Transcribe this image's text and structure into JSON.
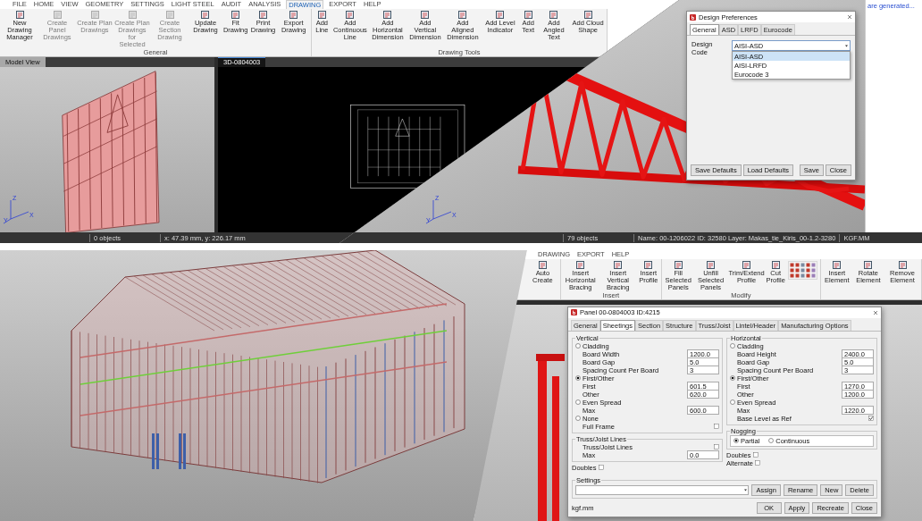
{
  "cad_window": {
    "ribbon_tabs": [
      {
        "label": "FILE",
        "selected": false
      },
      {
        "label": "HOME",
        "selected": false
      },
      {
        "label": "VIEW",
        "selected": false
      },
      {
        "label": "GEOMETRY",
        "selected": false
      },
      {
        "label": "SETTINGS",
        "selected": false
      },
      {
        "label": "LIGHT STEEL",
        "selected": false
      },
      {
        "label": "AUDIT",
        "selected": false
      },
      {
        "label": "ANALYSIS",
        "selected": false
      },
      {
        "label": "DRAWING",
        "selected": true
      },
      {
        "label": "EXPORT",
        "selected": false
      },
      {
        "label": "HELP",
        "selected": false
      }
    ],
    "ribbon_groups": [
      {
        "label": "General",
        "buttons": [
          {
            "label": "New Drawing Manager",
            "disabled": false
          },
          {
            "label": "Create Panel Drawings",
            "disabled": true
          },
          {
            "label": "Create Plan Drawings",
            "disabled": true
          },
          {
            "label": "Create Plan Drawings for Selected",
            "disabled": true
          },
          {
            "label": "Create Section Drawing",
            "disabled": true
          },
          {
            "label": "Update Drawing",
            "disabled": false
          },
          {
            "label": "Fit Drawing",
            "disabled": false
          },
          {
            "label": "Print Drawing",
            "disabled": false
          },
          {
            "label": "Export Drawing",
            "disabled": false
          }
        ]
      },
      {
        "label": "Drawing Tools",
        "buttons": [
          {
            "label": "Add Line",
            "disabled": false
          },
          {
            "label": "Add Continuous Line",
            "disabled": false
          },
          {
            "label": "Add Horizontal Dimension",
            "disabled": false
          },
          {
            "label": "Add Vertical Dimension",
            "disabled": false
          },
          {
            "label": "Add Aligned Dimension",
            "disabled": false
          },
          {
            "label": "Add Level Indicator",
            "disabled": false
          },
          {
            "label": "Add Text",
            "disabled": false
          },
          {
            "label": "Add Angled Text",
            "disabled": false
          },
          {
            "label": "Add Cloud Shape",
            "disabled": false
          }
        ]
      }
    ],
    "view_tabs": [
      {
        "label": "Model View",
        "selected": false
      },
      {
        "label": "3D-0804003",
        "selected": true
      }
    ],
    "axes": [
      "Z",
      "Y",
      "X"
    ],
    "status_bar": [
      "0 objects",
      "x: 47.39 mm, y: 226.17 mm"
    ]
  },
  "truss_window": {
    "axes": [
      "Z",
      "Y",
      "X"
    ],
    "dialog": {
      "title": "Design Preferences",
      "tabs": [
        {
          "label": "General",
          "selected": true
        },
        {
          "label": "ASD",
          "selected": false
        },
        {
          "label": "LRFD",
          "selected": false
        },
        {
          "label": "Eurocode",
          "selected": false
        }
      ],
      "field_label": "Design Code",
      "value": "AISI-ASD",
      "options": [
        {
          "label": "AISI-ASD",
          "selected": true
        },
        {
          "label": "AISI-LRFD",
          "selected": false
        },
        {
          "label": "Eurocode 3",
          "selected": false
        }
      ],
      "buttons": [
        "Save Defaults",
        "Load Defaults",
        "Save",
        "Close"
      ]
    },
    "status_bar": [
      "79 objects",
      "Name: 00-1206022 ID: 32580 Layer: Makas_tie_Kiris_00-1.2-3280",
      "KGF.MM"
    ],
    "side_note": "are generated..."
  },
  "panel_window": {
    "ribbon_tabs": [
      {
        "label": "DRAWING",
        "selected": false
      },
      {
        "label": "EXPORT",
        "selected": false
      },
      {
        "label": "HELP",
        "selected": false
      }
    ],
    "ribbon_groups": [
      {
        "buttons": [
          {
            "label": "Auto Create",
            "disabled": false
          }
        ]
      },
      {
        "label": "Insert",
        "buttons": [
          {
            "label": "Insert Horizontal Bracing",
            "disabled": false
          },
          {
            "label": "Insert Vertical Bracing",
            "disabled": false
          },
          {
            "label": "Insert Profile",
            "disabled": false
          }
        ]
      },
      {
        "label": "Modify",
        "icon_grid": true,
        "buttons": [
          {
            "label": "Fill Selected Panels",
            "disabled": false
          },
          {
            "label": "Unfill Selected Panels",
            "disabled": false
          },
          {
            "label": "Trim/Extend Profile",
            "disabled": false
          },
          {
            "label": "Cut Profile",
            "disabled": false
          }
        ]
      },
      {
        "buttons": [
          {
            "label": "Insert Element",
            "disabled": false
          },
          {
            "label": "Rotate Element",
            "disabled": false
          },
          {
            "label": "Remove Element",
            "disabled": false
          }
        ]
      }
    ],
    "dialog": {
      "title": "Panel 00-0804003 ID:4215",
      "tabs": [
        {
          "label": "General",
          "selected": false
        },
        {
          "label": "Sheetings",
          "selected": true
        },
        {
          "label": "Section",
          "selected": false
        },
        {
          "label": "Structure",
          "selected": false
        },
        {
          "label": "Truss/Joist",
          "selected": false
        },
        {
          "label": "Lintel/Header",
          "selected": false
        },
        {
          "label": "Manufacturing Options",
          "selected": false
        }
      ],
      "vertical": {
        "title": "Vertical",
        "rows": [
          {
            "kind": "radio",
            "label": "Cladding",
            "selected": false
          },
          {
            "kind": "field",
            "label": "Board Width",
            "value": "1200.0"
          },
          {
            "kind": "field",
            "label": "Board Gap",
            "value": "5.0"
          },
          {
            "kind": "field",
            "label": "Spacing Count Per Board",
            "value": "3"
          },
          {
            "kind": "radio",
            "label": "First/Other",
            "selected": true
          },
          {
            "kind": "field",
            "label": "First",
            "value": "601.5"
          },
          {
            "kind": "field",
            "label": "Other",
            "value": "620.0"
          },
          {
            "kind": "radio",
            "label": "Even Spread",
            "selected": false
          },
          {
            "kind": "field",
            "label": "Max",
            "value": "600.0"
          },
          {
            "kind": "radio",
            "label": "None",
            "selected": false
          },
          {
            "kind": "check",
            "label": "Full Frame",
            "checked": false
          }
        ]
      },
      "truss_lines": {
        "title": "Truss/Joist Lines",
        "rows": [
          {
            "kind": "check",
            "label": "Truss/Joist Lines",
            "checked": false
          },
          {
            "kind": "field",
            "label": "Max",
            "value": "0.0"
          }
        ]
      },
      "left_extra": [
        {
          "kind": "check",
          "label": "Doubles",
          "checked": false
        }
      ],
      "horizontal": {
        "title": "Horizontal",
        "rows": [
          {
            "kind": "radio",
            "label": "Cladding",
            "selected": false
          },
          {
            "kind": "field",
            "label": "Board Height",
            "value": "2400.0"
          },
          {
            "kind": "field",
            "label": "Board Gap",
            "value": "5.0"
          },
          {
            "kind": "field",
            "label": "Spacing Count Per Board",
            "value": "3"
          },
          {
            "kind": "radio",
            "label": "First/Other",
            "selected": true
          },
          {
            "kind": "field",
            "label": "First",
            "value": "1270.0"
          },
          {
            "kind": "field",
            "label": "Other",
            "value": "1200.0"
          },
          {
            "kind": "radio",
            "label": "Even Spread",
            "selected": false
          },
          {
            "kind": "field",
            "label": "Max",
            "value": "1220.0"
          },
          {
            "kind": "check",
            "label": "Base Level as Ref",
            "checked": true
          }
        ]
      },
      "nogging": {
        "title": "Nogging",
        "options": [
          {
            "label": "Partial",
            "selected": true
          },
          {
            "label": "Continuous",
            "selected": false
          }
        ]
      },
      "right_extra": [
        {
          "kind": "check",
          "label": "Doubles",
          "checked": false
        },
        {
          "kind": "check",
          "label": "Alternate",
          "checked": false
        }
      ],
      "settings": {
        "title": "Settings",
        "buttons": [
          "Assign",
          "Rename",
          "New",
          "Delete"
        ]
      },
      "unit": "kgf.mm",
      "buttons": [
        "OK",
        "Apply",
        "Recreate",
        "Close"
      ]
    }
  }
}
